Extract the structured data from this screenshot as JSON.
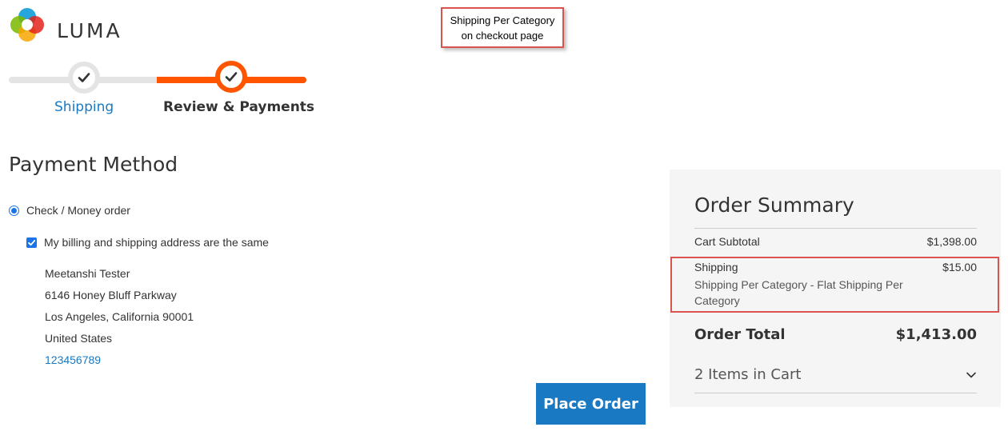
{
  "logo": {
    "text": "LUMA"
  },
  "callout": {
    "line1": "Shipping Per Category",
    "line2": "on checkout page"
  },
  "progress": {
    "steps": [
      {
        "label": "Shipping",
        "state": "completed"
      },
      {
        "label": "Review & Payments",
        "state": "active"
      }
    ]
  },
  "payment": {
    "title": "Payment Method",
    "method_label": "Check / Money order",
    "same_address_label": "My billing and shipping address are the same",
    "address": {
      "name": "Meetanshi Tester",
      "street": "6146 Honey Bluff Parkway",
      "city_line": "Los Angeles, California 90001",
      "country": "United States",
      "phone": "123456789"
    },
    "place_order_label": "Place Order"
  },
  "summary": {
    "title": "Order Summary",
    "subtotal_label": "Cart Subtotal",
    "subtotal_value": "$1,398.00",
    "shipping_label": "Shipping",
    "shipping_value": "$15.00",
    "shipping_method": "Shipping Per Category - Flat Shipping Per Category",
    "total_label": "Order Total",
    "total_value": "$1,413.00",
    "items_label": "2 Items in Cart"
  },
  "colors": {
    "accent_orange": "#ff5501",
    "link_blue": "#1979c3",
    "highlight_red": "#d9534f"
  }
}
